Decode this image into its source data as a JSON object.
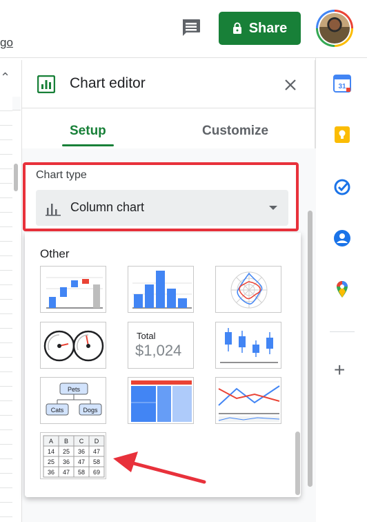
{
  "topbar": {
    "go_link": "go",
    "share_label": "Share"
  },
  "editor": {
    "title": "Chart editor",
    "tabs": [
      {
        "label": "Setup",
        "active": true
      },
      {
        "label": "Customize",
        "active": false
      }
    ],
    "chart_type_label": "Chart type",
    "chart_type_value": "Column chart",
    "dropdown": {
      "section_label": "Other",
      "items": [
        {
          "name": "Waterfall chart",
          "icon": "waterfall-chart-icon"
        },
        {
          "name": "Histogram chart",
          "icon": "histogram-chart-icon"
        },
        {
          "name": "Radar chart",
          "icon": "radar-chart-icon"
        },
        {
          "name": "Gauge chart",
          "icon": "gauge-chart-icon"
        },
        {
          "name": "Scorecard chart",
          "icon": "scorecard-chart-icon",
          "caption": "Total",
          "value": "$1,024"
        },
        {
          "name": "Candlestick chart",
          "icon": "candlestick-chart-icon"
        },
        {
          "name": "Organizational chart",
          "icon": "org-chart-icon",
          "nodes": [
            "Pets",
            "Cats",
            "Dogs"
          ]
        },
        {
          "name": "Tree map chart",
          "icon": "treemap-chart-icon"
        },
        {
          "name": "Timeline chart",
          "icon": "timeline-chart-icon"
        },
        {
          "name": "Table chart",
          "icon": "table-chart-icon",
          "table": {
            "header": [
              "A",
              "B",
              "C",
              "D"
            ],
            "rows": [
              [
                "14",
                "25",
                "36",
                "47"
              ],
              [
                "25",
                "36",
                "47",
                "58"
              ],
              [
                "36",
                "47",
                "58",
                "69"
              ]
            ]
          }
        }
      ]
    }
  },
  "rail": {
    "calendar_day": "31",
    "icons": [
      "calendar-icon",
      "keep-icon",
      "tasks-icon",
      "contacts-icon",
      "maps-icon",
      "add-icon"
    ]
  },
  "colors": {
    "share_green": "#188038",
    "highlight_red": "#e8313b",
    "accent_blue": "#4285f4"
  }
}
